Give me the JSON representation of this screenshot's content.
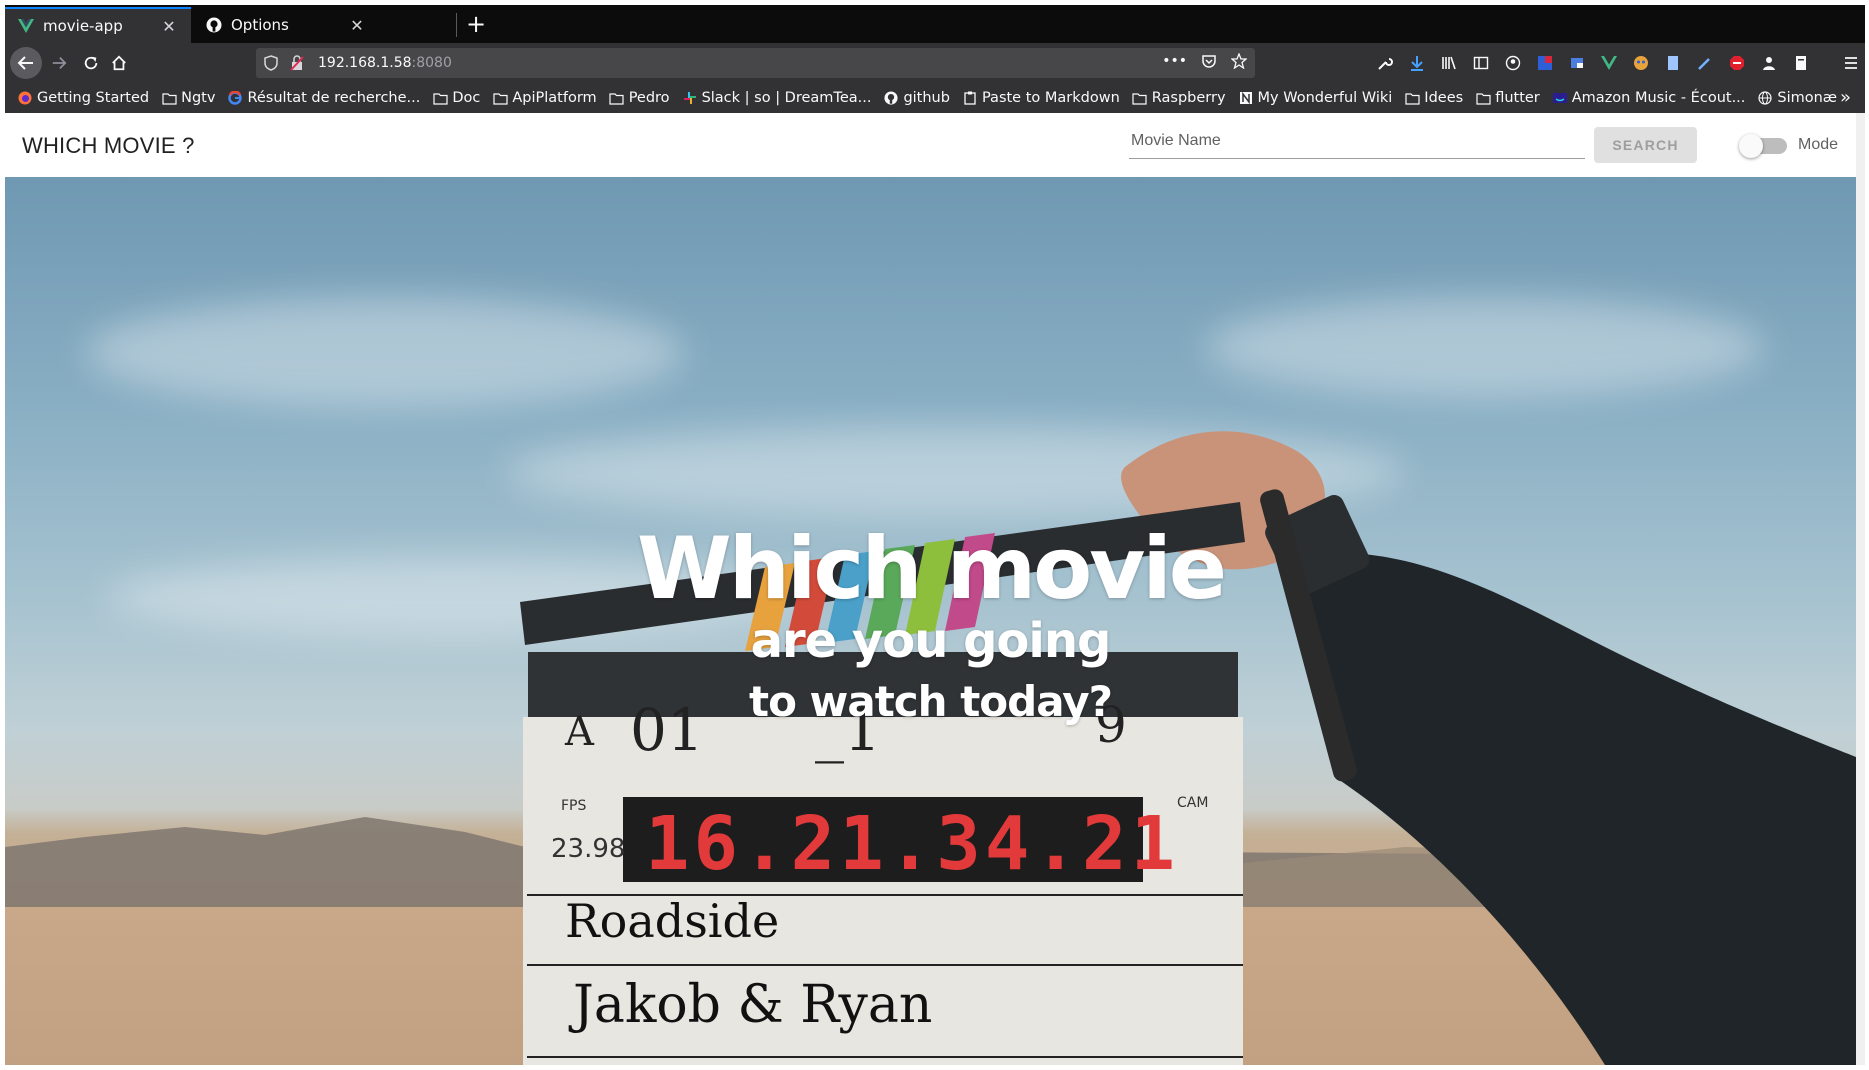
{
  "browser": {
    "tabs": [
      {
        "title": "movie-app",
        "active": true,
        "icon": "vue-logo-icon"
      },
      {
        "title": "Options",
        "active": false,
        "icon": "github-icon"
      }
    ],
    "url": {
      "host": "192.168.1.58",
      "port": ":8080"
    },
    "bookmarks": [
      {
        "label": "Getting Started",
        "icon": "firefox-icon"
      },
      {
        "label": "Ngtv",
        "icon": "folder-icon"
      },
      {
        "label": "Résultat de recherche...",
        "icon": "google-icon"
      },
      {
        "label": "Doc",
        "icon": "folder-icon"
      },
      {
        "label": "ApiPlatform",
        "icon": "folder-icon"
      },
      {
        "label": "Pedro",
        "icon": "folder-icon"
      },
      {
        "label": "Slack | so | DreamTea...",
        "icon": "slack-icon"
      },
      {
        "label": "github",
        "icon": "github-icon"
      },
      {
        "label": "Paste to Markdown",
        "icon": "clipboard-icon"
      },
      {
        "label": "Raspberry",
        "icon": "folder-icon"
      },
      {
        "label": "My Wonderful Wiki",
        "icon": "notion-icon"
      },
      {
        "label": "Idees",
        "icon": "folder-icon"
      },
      {
        "label": "flutter",
        "icon": "folder-icon"
      },
      {
        "label": "Amazon Music - Écout...",
        "icon": "amazon-music-icon"
      },
      {
        "label": "Simonæ",
        "icon": "globe-icon"
      }
    ]
  },
  "app": {
    "title": "WHICH MOVIE ?",
    "search": {
      "placeholder": "Movie Name",
      "value": "",
      "button_label": "SEARCH"
    },
    "mode_label": "Mode",
    "mode_on": false
  },
  "hero": {
    "line1": "Which movie",
    "line2": "are you going",
    "line3": "to watch today?"
  },
  "colors": {
    "accent_tab": "#0a84ff",
    "browser_dark": "#323234",
    "tabstrip": "#0c0c0d",
    "button_disabled": "#e0e0e0"
  }
}
